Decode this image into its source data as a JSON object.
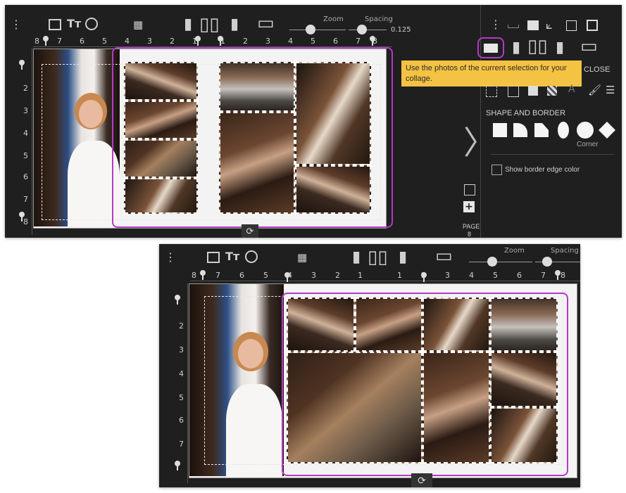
{
  "top": {
    "toolbar": {
      "menu_icon": "vertical-dots-icon",
      "image_icon": "image-icon",
      "text_icon_label": "Tт",
      "sticker_icon": "circle-icon",
      "layout_icon": "grid-icon",
      "zoom_label": "Zoom",
      "spacing_label": "Spacing",
      "spacing_value": "0.125",
      "zoom_level": 0.45,
      "spacing_level": 0.5
    },
    "ruler": {
      "h_numbers": [
        "8",
        "7",
        "6",
        "5",
        "4",
        "3",
        "2",
        "1",
        "1",
        "2",
        "3",
        "4",
        "5",
        "6",
        "7",
        "8"
      ],
      "v_numbers": [
        "2",
        "3",
        "4",
        "5",
        "6",
        "7",
        "8"
      ]
    },
    "right_panel": {
      "tooltip": "Use the photos of the current selection for your collage.",
      "close_label": "CLOSE",
      "shape_border_title": "SHAPE AND BORDER",
      "corner_label": "Corner",
      "border_edge_label": "Show border edge color",
      "page_label": "PAGE",
      "page_number": "8"
    }
  },
  "bottom": {
    "toolbar": {
      "zoom_label": "Zoom",
      "spacing_label": "Spacing",
      "zoom_level": 0.45,
      "spacing_level": 0.35
    },
    "ruler": {
      "h_numbers": [
        "8",
        "7",
        "6",
        "5",
        "4",
        "3",
        "2",
        "1",
        "1",
        "2",
        "3",
        "4",
        "5",
        "6",
        "7",
        "8"
      ],
      "v_numbers": [
        "2",
        "3",
        "4",
        "5",
        "6",
        "7"
      ]
    }
  },
  "colors": {
    "panel_bg": "#1f1f1f",
    "selection": "#b23bc4",
    "tooltip_bg": "#f5c343"
  }
}
